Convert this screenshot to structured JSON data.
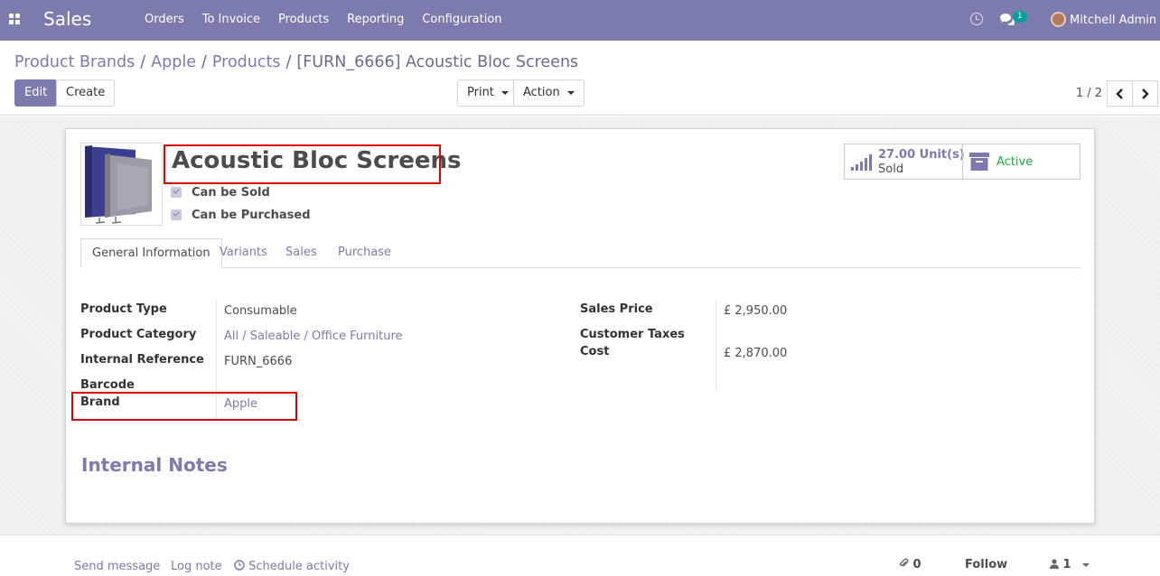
{
  "navbar": {
    "app_name": "Sales",
    "menu": [
      "Orders",
      "To Invoice",
      "Products",
      "Reporting",
      "Configuration"
    ],
    "chat_count": "1",
    "user_name": "Mitchell Admin",
    "color": "#7c7bad"
  },
  "breadcrumb": {
    "items": [
      "Product Brands",
      "Apple",
      "Products"
    ],
    "current": "[FURN_6666] Acoustic Bloc Screens",
    "sep": "/"
  },
  "toolbar": {
    "edit_label": "Edit",
    "create_label": "Create",
    "print_label": "Print",
    "action_label": "Action",
    "pager": "1 / 2"
  },
  "product": {
    "name": "Acoustic Bloc Screens",
    "can_be_sold_label": "Can be Sold",
    "can_be_sold": true,
    "can_be_purchased_label": "Can be Purchased",
    "can_be_purchased": true
  },
  "smart_buttons": {
    "sold_value": "27.00",
    "sold_unit": "Unit(s)",
    "sold_label": "Sold",
    "active_label": "Active"
  },
  "tabs": [
    "General Information",
    "Variants",
    "Sales",
    "Purchase"
  ],
  "fields_left": {
    "product_type_label": "Product Type",
    "product_type": "Consumable",
    "category_label": "Product Category",
    "category": "All / Saleable / Office Furniture",
    "internal_ref_label": "Internal Reference",
    "internal_ref": "FURN_6666",
    "barcode_label": "Barcode",
    "barcode": "",
    "brand_label": "Brand",
    "brand": "Apple"
  },
  "fields_right": {
    "sales_price_label": "Sales Price",
    "sales_price": "£ 2,950.00",
    "customer_taxes_label": "Customer Taxes",
    "customer_taxes": "",
    "cost_label": "Cost",
    "cost": "£ 2,870.00"
  },
  "notes_title": "Internal Notes",
  "chatter": {
    "send_message": "Send message",
    "log_note": "Log note",
    "schedule_activity": "Schedule activity",
    "attachments": "0",
    "follow": "Follow",
    "followers": "1"
  }
}
